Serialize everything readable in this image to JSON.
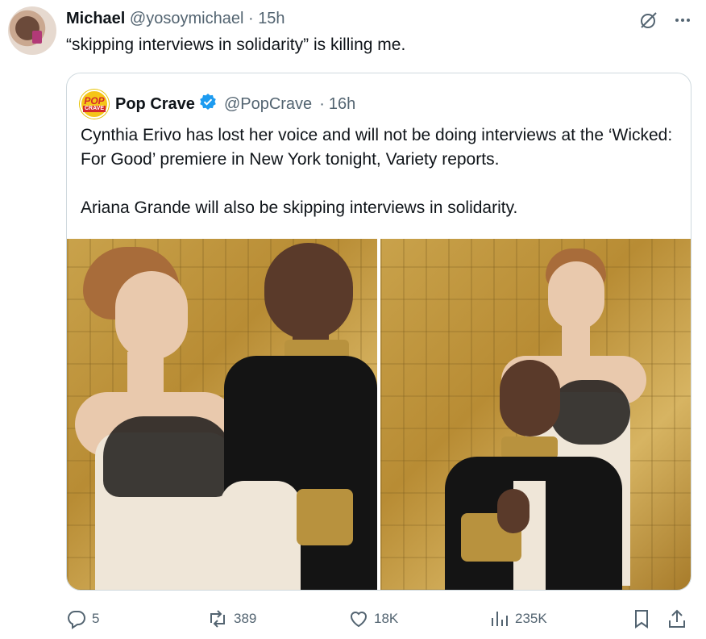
{
  "tweet": {
    "author_name": "Michael",
    "handle": "@yosoymichael",
    "time": "15h",
    "text": "“skipping interviews in solidarity” is killing me."
  },
  "quote": {
    "avatar_top": "POP",
    "avatar_bottom": "CRAVE",
    "author_name": "Pop Crave",
    "handle": "@PopCrave",
    "time": "16h",
    "paragraph_1": "Cynthia Erivo has lost her voice and will not be doing interviews at the ‘Wicked: For Good’ premiere in New York tonight, Variety reports.",
    "paragraph_2": "Ariana Grande will also be skipping interviews in solidarity."
  },
  "actions": {
    "replies": "5",
    "reposts": "389",
    "likes": "18K",
    "views": "235K"
  },
  "icons": {
    "top_right": [
      "grok-slash-icon",
      "more-icon"
    ],
    "actions": [
      "reply-icon",
      "repost-icon",
      "like-icon",
      "views-icon",
      "bookmark-icon",
      "share-icon"
    ]
  },
  "colors": {
    "text": "#0f1419",
    "secondary": "#536471",
    "verified": "#1d9bf0",
    "border": "#cfd9de"
  }
}
